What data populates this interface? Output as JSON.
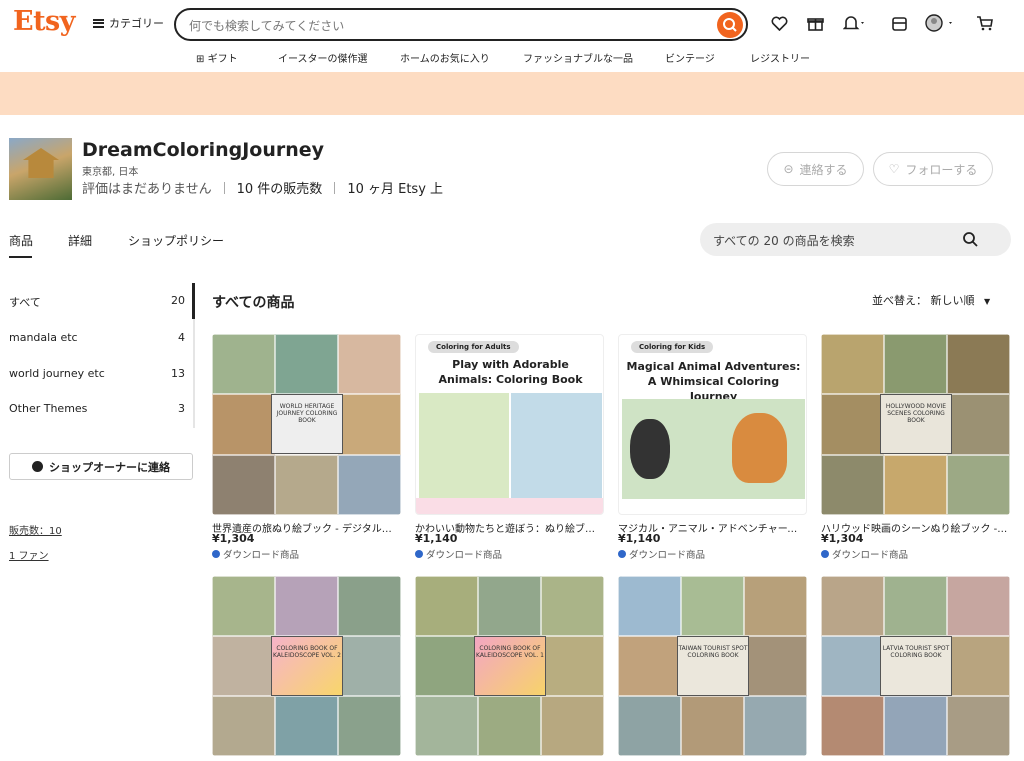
{
  "header": {
    "logo": "Etsy",
    "category": "カテゴリー",
    "search_placeholder": "何でも検索してみてください",
    "nav": [
      "ギフト",
      "イースターの傑作選",
      "ホームのお気に入り",
      "ファッショナブルな一品",
      "ビンテージ",
      "レジストリー"
    ]
  },
  "colors": {
    "accent": "#f1641e",
    "banner": "#fddcc2"
  },
  "shop": {
    "name": "DreamColoringJourney",
    "location": "東京都, 日本",
    "rating": "評価はまだありません",
    "sales": "10 件の販売数",
    "tenure": "10 ヶ月 Etsy 上",
    "contact": "連絡する",
    "follow": "フォローする"
  },
  "tabs": [
    "商品",
    "詳細",
    "ショップポリシー"
  ],
  "shop_search_placeholder": "すべての 20 の商品を検索",
  "sidebar": {
    "items": [
      {
        "label": "すべて",
        "count": "20"
      },
      {
        "label": "mandala etc",
        "count": "4"
      },
      {
        "label": "world journey etc",
        "count": "13"
      },
      {
        "label": "Other Themes",
        "count": "3"
      }
    ],
    "contact_owner": "ショップオーナーに連絡",
    "sales_link": "販売数：10",
    "fans_link": "1 ファン"
  },
  "main": {
    "title": "すべての商品",
    "sort": "並べ替え：  新しい順"
  },
  "products": [
    {
      "title": "世界遺産の旅ぬり絵ブック - デジタルダ…",
      "price": "¥1,304",
      "download": "ダウンロード商品",
      "cover_text": "WORLD HERITAGE JOURNEY COLORING BOOK"
    },
    {
      "title": "かわいい動物たちと遊ぼう：ぬり絵ブッ…",
      "price": "¥1,140",
      "download": "ダウンロード商品",
      "pill": "Coloring for Adults",
      "cover_title": "Play with Adorable Animals: Coloring Book"
    },
    {
      "title": "マジカル・アニマル・アドベンチャーズ…",
      "price": "¥1,140",
      "download": "ダウンロード商品",
      "pill": "Coloring for Kids",
      "cover_title": "Magical Animal Adventures: A Whimsical Coloring Journey"
    },
    {
      "title": "ハリウッド映画のシーンぬり絵ブック - …",
      "price": "¥1,304",
      "download": "ダウンロード商品",
      "cover_text": "HOLLYWOOD MOVIE SCENES COLORING BOOK"
    },
    {
      "cover_text": "COLORING BOOK OF KALEIDOSCOPE VOL. 2"
    },
    {
      "cover_text": "COLORING BOOK OF KALEIDOSCOPE VOL. 1"
    },
    {
      "cover_text": "TAIWAN TOURIST SPOT COLORING BOOK"
    },
    {
      "cover_text": "LATVIA TOURIST SPOT COLORING BOOK"
    }
  ]
}
